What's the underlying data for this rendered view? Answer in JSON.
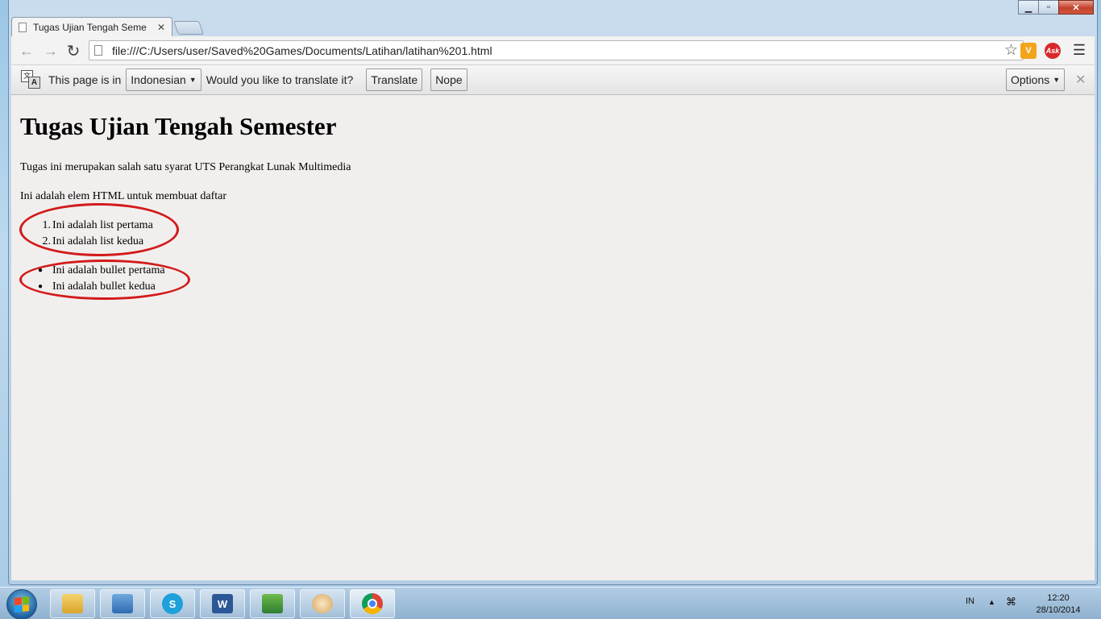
{
  "window": {
    "minimize_glyph": "▁",
    "maximize_glyph": "▫",
    "close_glyph": "✕"
  },
  "tab": {
    "title": "Tugas Ujian Tengah Seme",
    "close_glyph": "✕"
  },
  "toolbar": {
    "back_glyph": "←",
    "forward_glyph": "→",
    "reload_glyph": "↻",
    "url": "file:///C:/Users/user/Saved%20Games/Documents/Latihan/latihan%201.html",
    "star_glyph": "☆",
    "ext_v_label": "V",
    "ext_ask_label": "Ask",
    "menu_glyph": "☰"
  },
  "translate_bar": {
    "prefix": "This page is in",
    "language": "Indonesian",
    "question": "Would you like to translate it?",
    "translate_label": "Translate",
    "nope_label": "Nope",
    "options_label": "Options",
    "close_glyph": "✕",
    "icon_a": "文",
    "icon_b": "A"
  },
  "page": {
    "heading": "Tugas Ujian Tengah Semester",
    "paragraph1": "Tugas ini merupakan salah satu syarat UTS Perangkat Lunak Multimedia",
    "paragraph2": "Ini adalah elem HTML untuk membuat daftar",
    "ordered_list": [
      {
        "marker": "1.",
        "text": "Ini adalah list pertama"
      },
      {
        "marker": "2.",
        "text": "Ini adalah list kedua"
      }
    ],
    "bullet_list": [
      {
        "marker": "●",
        "text": "Ini adalah bullet pertama"
      },
      {
        "marker": "●",
        "text": "Ini adalah bullet kedua"
      }
    ],
    "highlight_color": "#d21b1b"
  },
  "taskbar": {
    "word_label": "W",
    "skype_label": "S",
    "tray_language": "IN",
    "tray_arrow": "▲",
    "tray_network": "⌘",
    "clock_time": "12:20",
    "clock_date": "28/10/2014"
  }
}
